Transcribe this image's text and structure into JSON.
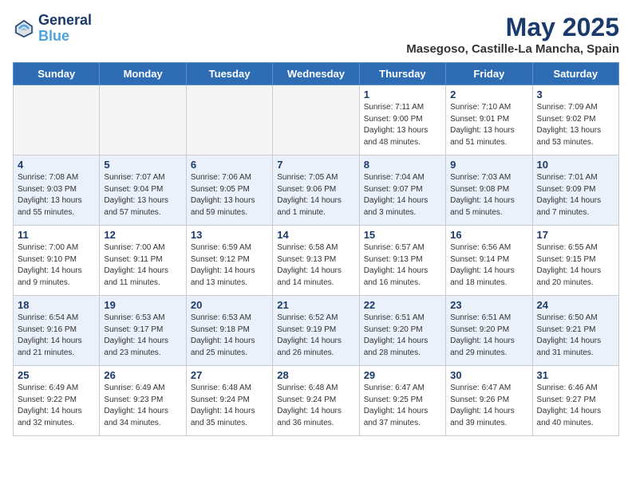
{
  "header": {
    "logo_line1": "General",
    "logo_line2": "Blue",
    "title": "May 2025",
    "subtitle": "Masegoso, Castille-La Mancha, Spain"
  },
  "weekdays": [
    "Sunday",
    "Monday",
    "Tuesday",
    "Wednesday",
    "Thursday",
    "Friday",
    "Saturday"
  ],
  "weeks": [
    [
      {
        "day": "",
        "info": ""
      },
      {
        "day": "",
        "info": ""
      },
      {
        "day": "",
        "info": ""
      },
      {
        "day": "",
        "info": ""
      },
      {
        "day": "1",
        "info": "Sunrise: 7:11 AM\nSunset: 9:00 PM\nDaylight: 13 hours\nand 48 minutes."
      },
      {
        "day": "2",
        "info": "Sunrise: 7:10 AM\nSunset: 9:01 PM\nDaylight: 13 hours\nand 51 minutes."
      },
      {
        "day": "3",
        "info": "Sunrise: 7:09 AM\nSunset: 9:02 PM\nDaylight: 13 hours\nand 53 minutes."
      }
    ],
    [
      {
        "day": "4",
        "info": "Sunrise: 7:08 AM\nSunset: 9:03 PM\nDaylight: 13 hours\nand 55 minutes."
      },
      {
        "day": "5",
        "info": "Sunrise: 7:07 AM\nSunset: 9:04 PM\nDaylight: 13 hours\nand 57 minutes."
      },
      {
        "day": "6",
        "info": "Sunrise: 7:06 AM\nSunset: 9:05 PM\nDaylight: 13 hours\nand 59 minutes."
      },
      {
        "day": "7",
        "info": "Sunrise: 7:05 AM\nSunset: 9:06 PM\nDaylight: 14 hours\nand 1 minute."
      },
      {
        "day": "8",
        "info": "Sunrise: 7:04 AM\nSunset: 9:07 PM\nDaylight: 14 hours\nand 3 minutes."
      },
      {
        "day": "9",
        "info": "Sunrise: 7:03 AM\nSunset: 9:08 PM\nDaylight: 14 hours\nand 5 minutes."
      },
      {
        "day": "10",
        "info": "Sunrise: 7:01 AM\nSunset: 9:09 PM\nDaylight: 14 hours\nand 7 minutes."
      }
    ],
    [
      {
        "day": "11",
        "info": "Sunrise: 7:00 AM\nSunset: 9:10 PM\nDaylight: 14 hours\nand 9 minutes."
      },
      {
        "day": "12",
        "info": "Sunrise: 7:00 AM\nSunset: 9:11 PM\nDaylight: 14 hours\nand 11 minutes."
      },
      {
        "day": "13",
        "info": "Sunrise: 6:59 AM\nSunset: 9:12 PM\nDaylight: 14 hours\nand 13 minutes."
      },
      {
        "day": "14",
        "info": "Sunrise: 6:58 AM\nSunset: 9:13 PM\nDaylight: 14 hours\nand 14 minutes."
      },
      {
        "day": "15",
        "info": "Sunrise: 6:57 AM\nSunset: 9:13 PM\nDaylight: 14 hours\nand 16 minutes."
      },
      {
        "day": "16",
        "info": "Sunrise: 6:56 AM\nSunset: 9:14 PM\nDaylight: 14 hours\nand 18 minutes."
      },
      {
        "day": "17",
        "info": "Sunrise: 6:55 AM\nSunset: 9:15 PM\nDaylight: 14 hours\nand 20 minutes."
      }
    ],
    [
      {
        "day": "18",
        "info": "Sunrise: 6:54 AM\nSunset: 9:16 PM\nDaylight: 14 hours\nand 21 minutes."
      },
      {
        "day": "19",
        "info": "Sunrise: 6:53 AM\nSunset: 9:17 PM\nDaylight: 14 hours\nand 23 minutes."
      },
      {
        "day": "20",
        "info": "Sunrise: 6:53 AM\nSunset: 9:18 PM\nDaylight: 14 hours\nand 25 minutes."
      },
      {
        "day": "21",
        "info": "Sunrise: 6:52 AM\nSunset: 9:19 PM\nDaylight: 14 hours\nand 26 minutes."
      },
      {
        "day": "22",
        "info": "Sunrise: 6:51 AM\nSunset: 9:20 PM\nDaylight: 14 hours\nand 28 minutes."
      },
      {
        "day": "23",
        "info": "Sunrise: 6:51 AM\nSunset: 9:20 PM\nDaylight: 14 hours\nand 29 minutes."
      },
      {
        "day": "24",
        "info": "Sunrise: 6:50 AM\nSunset: 9:21 PM\nDaylight: 14 hours\nand 31 minutes."
      }
    ],
    [
      {
        "day": "25",
        "info": "Sunrise: 6:49 AM\nSunset: 9:22 PM\nDaylight: 14 hours\nand 32 minutes."
      },
      {
        "day": "26",
        "info": "Sunrise: 6:49 AM\nSunset: 9:23 PM\nDaylight: 14 hours\nand 34 minutes."
      },
      {
        "day": "27",
        "info": "Sunrise: 6:48 AM\nSunset: 9:24 PM\nDaylight: 14 hours\nand 35 minutes."
      },
      {
        "day": "28",
        "info": "Sunrise: 6:48 AM\nSunset: 9:24 PM\nDaylight: 14 hours\nand 36 minutes."
      },
      {
        "day": "29",
        "info": "Sunrise: 6:47 AM\nSunset: 9:25 PM\nDaylight: 14 hours\nand 37 minutes."
      },
      {
        "day": "30",
        "info": "Sunrise: 6:47 AM\nSunset: 9:26 PM\nDaylight: 14 hours\nand 39 minutes."
      },
      {
        "day": "31",
        "info": "Sunrise: 6:46 AM\nSunset: 9:27 PM\nDaylight: 14 hours\nand 40 minutes."
      }
    ]
  ]
}
